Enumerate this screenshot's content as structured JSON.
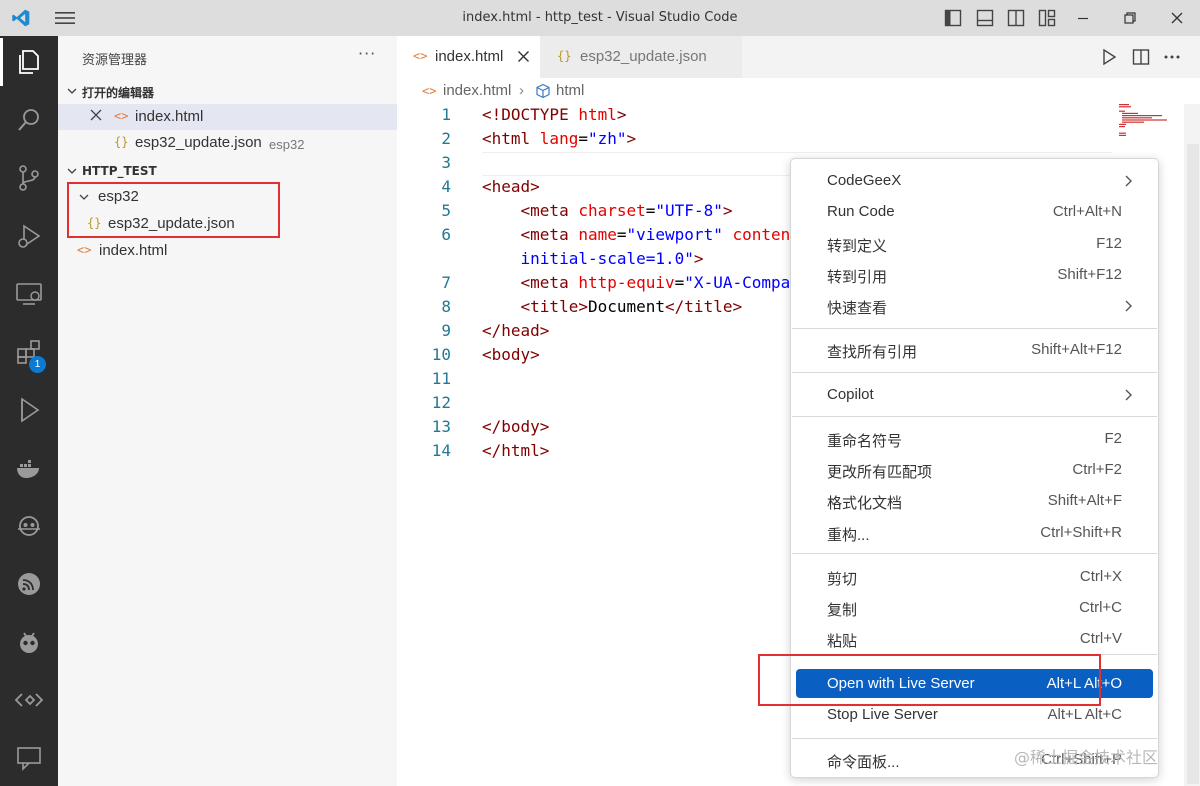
{
  "window": {
    "title": "index.html - http_test - Visual Studio Code"
  },
  "activity_bar": {
    "extensions_badge": "1",
    "items": [
      "explorer-icon",
      "search-icon",
      "source-control-icon",
      "run-debug-icon",
      "remote-explorer-icon",
      "extensions-icon",
      "live-share-icon",
      "docker-icon",
      "copilot-icon",
      "esp-idf-icon",
      "platformio-icon",
      "live-server-icon",
      "feedback-icon"
    ]
  },
  "sidebar": {
    "title": "资源管理器",
    "more": "···",
    "open_editors": {
      "header": "打开的编辑器",
      "items": [
        {
          "icon": "<>",
          "name": "index.html",
          "desc": ""
        },
        {
          "icon": "{}",
          "name": "esp32_update.json",
          "desc": "esp32"
        }
      ]
    },
    "project": {
      "header": "HTTP_TEST",
      "folder": "esp32",
      "folder_file": {
        "icon": "{}",
        "name": "esp32_update.json"
      },
      "root_file": {
        "icon": "<>",
        "name": "index.html"
      }
    }
  },
  "tabs": [
    {
      "icon": "<>",
      "label": "index.html",
      "active": true
    },
    {
      "icon": "{}",
      "label": "esp32_update.json",
      "active": false
    }
  ],
  "breadcrumb": {
    "file": "index.html",
    "symbol": "html"
  },
  "code_lines": [
    {
      "n": "1",
      "tokens": [
        [
          "t",
          "<!DOCTYPE "
        ],
        [
          "a",
          "html"
        ],
        [
          "t",
          ">"
        ]
      ]
    },
    {
      "n": "2",
      "tokens": [
        [
          "t",
          "<html "
        ],
        [
          "a",
          "lang"
        ],
        [
          "x",
          "="
        ],
        [
          "v",
          "\"zh\""
        ],
        [
          "t",
          ">"
        ]
      ]
    },
    {
      "n": "3",
      "tokens": []
    },
    {
      "n": "4",
      "tokens": [
        [
          "t",
          "<head>"
        ]
      ]
    },
    {
      "n": "5",
      "tokens": [
        [
          "x",
          "    "
        ],
        [
          "t",
          "<meta "
        ],
        [
          "a",
          "charset"
        ],
        [
          "x",
          "="
        ],
        [
          "v",
          "\"UTF-8\""
        ],
        [
          "t",
          ">"
        ]
      ]
    },
    {
      "n": "6",
      "tokens": [
        [
          "x",
          "    "
        ],
        [
          "t",
          "<meta "
        ],
        [
          "a",
          "name"
        ],
        [
          "x",
          "="
        ],
        [
          "v",
          "\"viewport\""
        ],
        [
          "x",
          " "
        ],
        [
          "a",
          "content"
        ]
      ]
    },
    {
      "n": "",
      "tokens": [
        [
          "x",
          "    "
        ],
        [
          "v",
          "initial-scale=1.0\""
        ],
        [
          "t",
          ">"
        ]
      ]
    },
    {
      "n": "7",
      "tokens": [
        [
          "x",
          "    "
        ],
        [
          "t",
          "<meta "
        ],
        [
          "a",
          "http-equiv"
        ],
        [
          "x",
          "="
        ],
        [
          "v",
          "\"X-UA-Compa"
        ]
      ]
    },
    {
      "n": "8",
      "tokens": [
        [
          "x",
          "    "
        ],
        [
          "t",
          "<title>"
        ],
        [
          "x",
          "Document"
        ],
        [
          "t",
          "</title>"
        ]
      ]
    },
    {
      "n": "9",
      "tokens": [
        [
          "t",
          "</head>"
        ]
      ]
    },
    {
      "n": "10",
      "tokens": [
        [
          "t",
          "<body>"
        ]
      ]
    },
    {
      "n": "11",
      "tokens": []
    },
    {
      "n": "12",
      "tokens": []
    },
    {
      "n": "13",
      "tokens": [
        [
          "t",
          "</body>"
        ]
      ]
    },
    {
      "n": "14",
      "tokens": [
        [
          "t",
          "</html>"
        ]
      ]
    }
  ],
  "context_menu": {
    "items": [
      {
        "label": "CodeGeeX",
        "shortcut": "",
        "submenu": true
      },
      {
        "label": "Run Code",
        "shortcut": "Ctrl+Alt+N"
      },
      {
        "label": "转到定义",
        "shortcut": "F12"
      },
      {
        "label": "转到引用",
        "shortcut": "Shift+F12"
      },
      {
        "label": "快速查看",
        "shortcut": "",
        "submenu": true
      },
      {
        "label": "查找所有引用",
        "shortcut": "Shift+Alt+F12"
      },
      {
        "label": "Copilot",
        "shortcut": "",
        "submenu": true
      },
      {
        "label": "重命名符号",
        "shortcut": "F2"
      },
      {
        "label": "更改所有匹配项",
        "shortcut": "Ctrl+F2"
      },
      {
        "label": "格式化文档",
        "shortcut": "Shift+Alt+F"
      },
      {
        "label": "重构...",
        "shortcut": "Ctrl+Shift+R"
      },
      {
        "label": "剪切",
        "shortcut": "Ctrl+X"
      },
      {
        "label": "复制",
        "shortcut": "Ctrl+C"
      },
      {
        "label": "粘贴",
        "shortcut": "Ctrl+V"
      },
      {
        "label": "Open with Live Server",
        "shortcut": "Alt+L Alt+O",
        "highlighted": true
      },
      {
        "label": "Stop Live Server",
        "shortcut": "Alt+L Alt+C"
      },
      {
        "label": "命令面板...",
        "shortcut": "Ctrl+Shift+P"
      }
    ]
  },
  "watermark": "@稀土掘金技术社区",
  "colors": {
    "accent": "#0a60c2",
    "annotation_box": "#e03030",
    "activity_bar": "#2c2c2c",
    "titlebar": "#dddddd"
  }
}
